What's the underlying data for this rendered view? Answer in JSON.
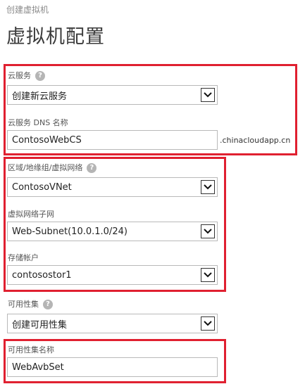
{
  "header": {
    "breadcrumb": "创建虚拟机",
    "title": "虚拟机配置"
  },
  "cloud_service": {
    "label": "云服务",
    "value": "创建新云服务",
    "dns_label": "云服务 DNS 名称",
    "dns_value": "ContosoWebCS",
    "dns_suffix": ".chinacloudapp.cn"
  },
  "network": {
    "region_label": "区域/地缘组/虚拟网络",
    "region_value": "ContosoVNet",
    "subnet_label": "虚拟网络子网",
    "subnet_value": "Web-Subnet(10.0.1.0/24)",
    "storage_label": "存储帐户",
    "storage_value": "contosostor1"
  },
  "availability": {
    "label": "可用性集",
    "value": "创建可用性集",
    "name_label": "可用性集名称",
    "name_value": "WebAvbSet"
  },
  "icons": {
    "help": "question-icon",
    "dropdown": "chevron-down-icon"
  },
  "colors": {
    "highlight_border": "#e02030",
    "title": "#3c3c3c"
  }
}
